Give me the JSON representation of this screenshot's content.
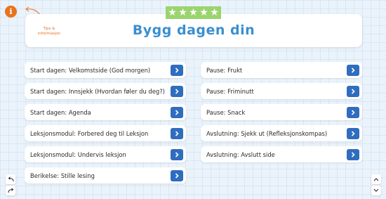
{
  "header": {
    "title": "Bygg dagen din",
    "tips_label_line1": "Tips &",
    "tips_label_line2": "informasjon",
    "info_icon": "i",
    "stars_icon": "★★★★★",
    "accent_orange": "#e8731f",
    "title_color": "#3a8fcf",
    "stars_color": "#9ad46e"
  },
  "left_items": [
    {
      "label": "Start dagen: Velkomstside (God morgen)"
    },
    {
      "label": "Start dagen: Innsjekk (Hvordan føler du deg?)"
    },
    {
      "label": "Start dagen: Agenda"
    },
    {
      "label": "Leksjonsmodul: Forbered deg til Leksjon"
    },
    {
      "label": "Leksjonsmodul: Undervis leksjon"
    },
    {
      "label": "Berikelse: Stille lesing"
    }
  ],
  "right_items": [
    {
      "label": "Pause: Frukt"
    },
    {
      "label": "Pause: Friminutt"
    },
    {
      "label": "Pause: Snack"
    },
    {
      "label": "Avslutning: Sjekk ut (Refleksjonskompas)"
    },
    {
      "label": "Avslutning: Avslutt side"
    }
  ],
  "colors": {
    "button_blue": "#2f6dbf"
  },
  "icons": {
    "go": "chevron-right-icon",
    "undo": "undo-icon",
    "redo": "redo-icon",
    "scroll_up": "chevron-up-icon",
    "scroll_down": "chevron-down-icon"
  }
}
